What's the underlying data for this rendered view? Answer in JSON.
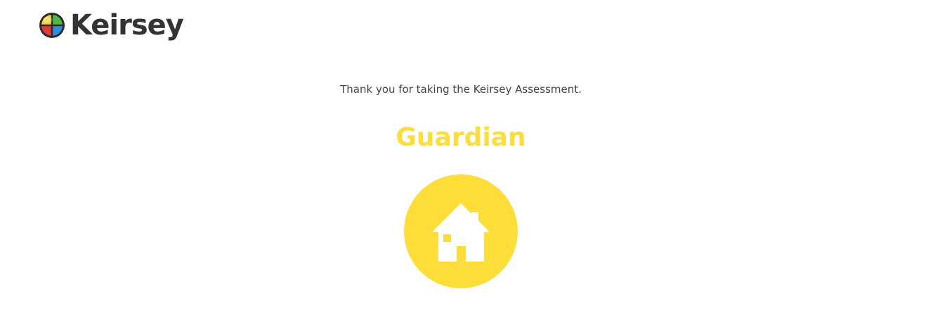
{
  "header": {
    "logo_text": "Keirsey"
  },
  "result": {
    "thanks_message": "Thank you for taking the Keirsey Assessment.",
    "temperament": "Guardian",
    "icon": "house-icon"
  },
  "colors": {
    "accent": "#fcdd3a",
    "logo_text": "#333333",
    "body_text": "#444444",
    "background": "#ffffff"
  }
}
